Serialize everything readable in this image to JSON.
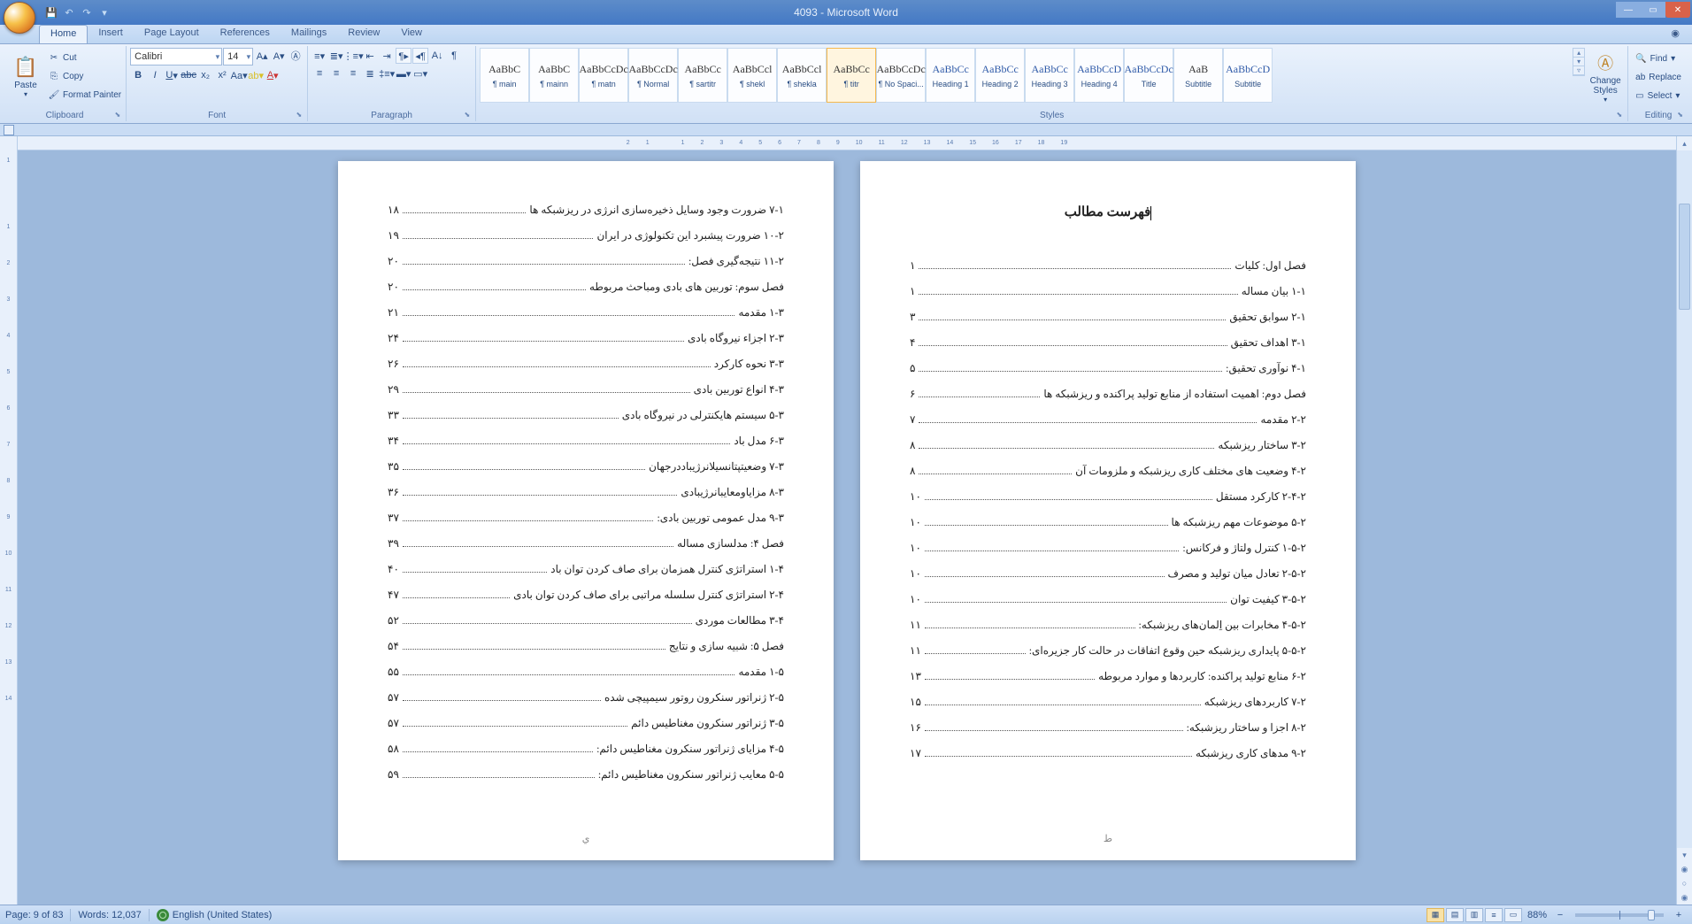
{
  "window": {
    "title": "4093 - Microsoft Word"
  },
  "tabs": [
    "Home",
    "Insert",
    "Page Layout",
    "References",
    "Mailings",
    "Review",
    "View"
  ],
  "clipboard": {
    "paste": "Paste",
    "cut": "Cut",
    "copy": "Copy",
    "format_painter": "Format Painter",
    "label": "Clipboard"
  },
  "font": {
    "name": "Calibri",
    "size": "14",
    "label": "Font"
  },
  "paragraph": {
    "label": "Paragraph"
  },
  "styles": {
    "label": "Styles",
    "change": "Change\nStyles",
    "items": [
      {
        "preview": "AaBbC",
        "name": "¶ main",
        "blue": false
      },
      {
        "preview": "AaBbC",
        "name": "¶ mainn",
        "blue": false
      },
      {
        "preview": "AaBbCcDc",
        "name": "¶ matn",
        "blue": false
      },
      {
        "preview": "AaBbCcDc",
        "name": "¶ Normal",
        "blue": false
      },
      {
        "preview": "AaBbCc",
        "name": "¶ sartitr",
        "blue": false
      },
      {
        "preview": "AaBbCcl",
        "name": "¶ shekl",
        "blue": false
      },
      {
        "preview": "AaBbCcl",
        "name": "¶ shekla",
        "blue": false
      },
      {
        "preview": "AaBbCc",
        "name": "¶ titr",
        "blue": false,
        "sel": true
      },
      {
        "preview": "AaBbCcDc",
        "name": "¶ No Spaci...",
        "blue": false
      },
      {
        "preview": "AaBbCc",
        "name": "Heading 1",
        "blue": true
      },
      {
        "preview": "AaBbCc",
        "name": "Heading 2",
        "blue": true
      },
      {
        "preview": "AaBbCc",
        "name": "Heading 3",
        "blue": true
      },
      {
        "preview": "AaBbCcD",
        "name": "Heading 4",
        "blue": true
      },
      {
        "preview": "AaBbCcDc",
        "name": "Title",
        "blue": true
      },
      {
        "preview": "AaB",
        "name": "Subtitle",
        "blue": false
      },
      {
        "preview": "AaBbCcD",
        "name": "Subtitle",
        "blue": true
      }
    ]
  },
  "editing": {
    "find": "Find",
    "replace": "Replace",
    "select": "Select",
    "label": "Editing"
  },
  "ruler_h": [
    "19",
    "18",
    "17",
    "16",
    "15",
    "14",
    "13",
    "12",
    "11",
    "10",
    "9",
    "8",
    "7",
    "6",
    "5",
    "4",
    "3",
    "2",
    "1",
    "",
    "1",
    "2"
  ],
  "ruler_v": [
    "1",
    "",
    "1",
    "2",
    "3",
    "4",
    "5",
    "6",
    "7",
    "8",
    "9",
    "10",
    "11",
    "12",
    "13",
    "14"
  ],
  "doc": {
    "toc_title": "فهرست مطالب",
    "foot_right": "ط",
    "foot_left": "ي",
    "right_page": [
      {
        "t": "فصل اول: کلیات",
        "p": "۱"
      },
      {
        "t": "۱-۱ بیان مساله",
        "p": "۱"
      },
      {
        "t": "۲-۱ سوابق تحقیق",
        "p": "۳"
      },
      {
        "t": "۳-۱ اهداف تحقیق",
        "p": "۴"
      },
      {
        "t": "۴-۱ نوآوری تحقیق:",
        "p": "۵"
      },
      {
        "t": "فصل دوم: اهمیت استفاده از منابع تولید پراکنده و ریزشبکه ها",
        "p": "۶"
      },
      {
        "t": "۲-۲   مقدمه",
        "p": "۷"
      },
      {
        "t": "۳-۲ ساختار ریزشبکه",
        "p": "۸"
      },
      {
        "t": "۴-۲ وضعیت های مختلف کاری ریزشبکه و ملزومات آن",
        "p": "۸"
      },
      {
        "t": "۲-۴-۲ کارکرد مستقل",
        "p": "۱۰"
      },
      {
        "t": "۵-۲   موضوعات مهم ریزشبکه ها",
        "p": "۱۰"
      },
      {
        "t": "۱-۵-۲ کنترل ولتاژ و فرکانس:",
        "p": "۱۰"
      },
      {
        "t": "۲-۵-۲ تعادل میان تولید و مصرف",
        "p": "۱۰"
      },
      {
        "t": "۳-۵-۲ کیفیت توان",
        "p": "۱۰"
      },
      {
        "t": "۴-۵-۲ مخابرات بین اِلمان‌های ریزشبکه:",
        "p": "۱۱"
      },
      {
        "t": "۵-۵-۲ پایداری ریزشبکه حین وقوع اتفاقات در حالت کار جزیره‌ای:",
        "p": "۱۱"
      },
      {
        "t": "۶-۲   منابع تولید پراکنده: کاربردها و موارد مربوطه",
        "p": "۱۳"
      },
      {
        "t": "۷-۲ کاربردهای ریزشبکه",
        "p": "۱۵"
      },
      {
        "t": "۸-۲ اجزا و ساختار ریزشبکه:",
        "p": "۱۶"
      },
      {
        "t": "۹-۲ مدهای کاری ریزشبکه",
        "p": "۱۷"
      }
    ],
    "left_page": [
      {
        "t": "۷-۱ ضرورت وجود وسایل ذخیره‌سازی انرژی در ریزشبکه ها",
        "p": "۱۸"
      },
      {
        "t": "۱۰-۲ ضرورت پیشبرد این تکنولوژی در ایران",
        "p": "۱۹"
      },
      {
        "t": "۱۱-۲ نتیجه‌گیری فصل:",
        "p": "۲۰"
      },
      {
        "t": "فصل سوم: توربین های بادی ومباحث مربوطه",
        "p": "۲۰"
      },
      {
        "t": "۱-۳ مقدمه",
        "p": "۲۱"
      },
      {
        "t": "۲-۳ اجزاء نیروگاه بادی",
        "p": "۲۴"
      },
      {
        "t": "۳-۳   نحوه کارکرد",
        "p": "۲۶"
      },
      {
        "t": "۴-۳ انواع توربین بادی",
        "p": "۲۹"
      },
      {
        "t": "۵-۳ سیستم هایکنترلی در نیروگاه بادی",
        "p": "۳۳"
      },
      {
        "t": "۶-۳ مدل باد",
        "p": "۳۴"
      },
      {
        "t": "۷-۳ وضعیتپتانسیلانرژیباددرجهان",
        "p": "۳۵"
      },
      {
        "t": "۸-۳ مزایاومعایبانرژیبادی",
        "p": "۳۶"
      },
      {
        "t": "۹-۳ مدل عمومی توربین بادی:",
        "p": "۳۷"
      },
      {
        "t": "فصل ۴: مدلسازی مساله",
        "p": "۳۹"
      },
      {
        "t": "۱-۴ استراتژی کنترل همزمان برای صاف کردن توان باد",
        "p": "۴۰"
      },
      {
        "t": "۲-۴ استراتژی کنترل سلسله مراتبی برای صاف کردن توان بادی",
        "p": "۴۷"
      },
      {
        "t": "۳-۴ مطالعات موردی",
        "p": "۵۲"
      },
      {
        "t": "فصل ۵: شبیه سازی و نتایج",
        "p": "۵۴"
      },
      {
        "t": "۱-۵ مقدمه",
        "p": "۵۵"
      },
      {
        "t": "۲-۵ ژنراتور سنکرون روتور سیمپیچی شده",
        "p": "۵۷"
      },
      {
        "t": "۳-۵ ژنراتور سنکرون مغناطیس دائم",
        "p": "۵۷"
      },
      {
        "t": "۴-۵ مزایای ژنراتور سنکرون مغناطیس دائم:",
        "p": "۵۸"
      },
      {
        "t": "۵-۵ معایب ژنراتور سنکرون مغناطیس دائم:",
        "p": "۵۹"
      }
    ]
  },
  "status": {
    "page": "Page: 9 of 83",
    "words": "Words: 12,037",
    "lang": "English (United States)",
    "zoom": "88%"
  }
}
